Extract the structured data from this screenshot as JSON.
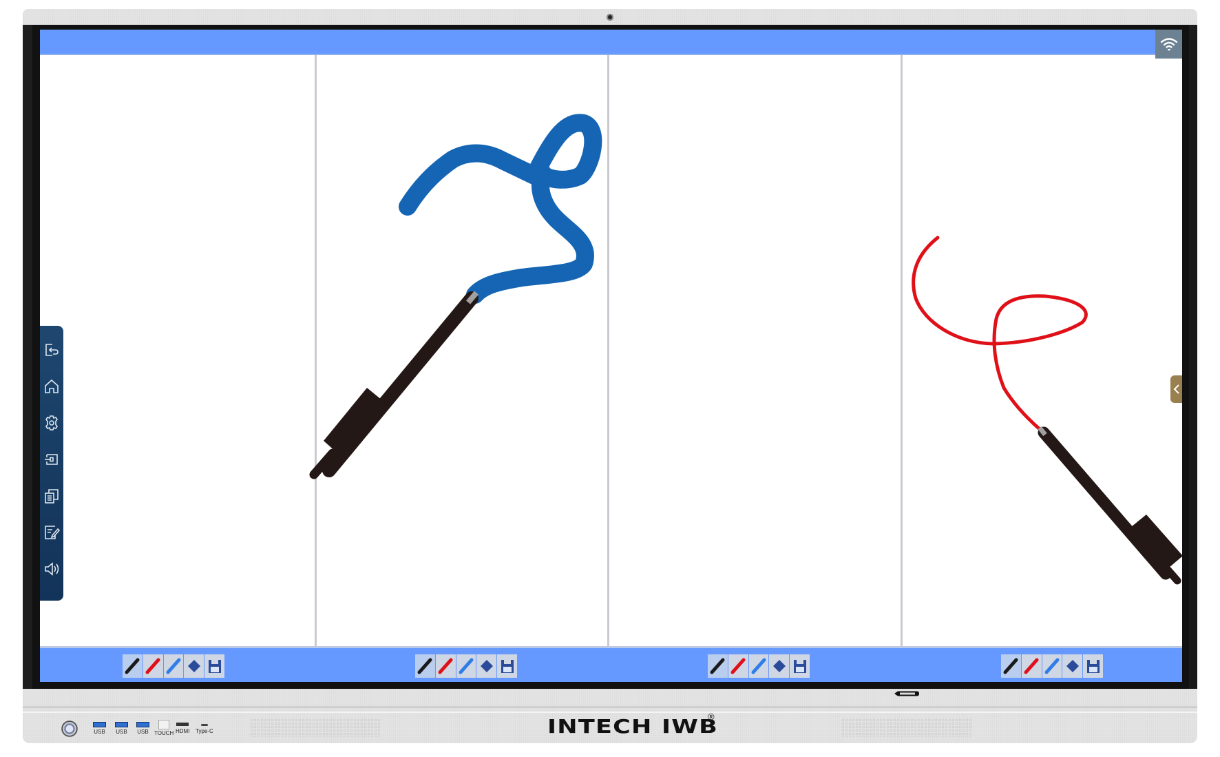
{
  "device": {
    "brand_logo": "INTECH IWB",
    "registered_mark": "®"
  },
  "screen": {
    "topbar_color": "#6699ff",
    "status": {
      "wifi_icon": "wifi-icon"
    },
    "panels_count": 4
  },
  "sidebar": {
    "items": [
      {
        "name": "back",
        "icon": "back-icon"
      },
      {
        "name": "home",
        "icon": "home-icon"
      },
      {
        "name": "settings",
        "icon": "gear-icon"
      },
      {
        "name": "input-source",
        "icon": "input-source-icon"
      },
      {
        "name": "multitask",
        "icon": "windows-icon"
      },
      {
        "name": "annotate",
        "icon": "annotate-icon"
      },
      {
        "name": "volume",
        "icon": "volume-icon"
      }
    ]
  },
  "panels": [
    {
      "stroke_color": "",
      "has_drawing": false
    },
    {
      "stroke_color": "#1565b4",
      "has_drawing": true
    },
    {
      "stroke_color": "",
      "has_drawing": false
    },
    {
      "stroke_color": "#e01018",
      "has_drawing": true
    }
  ],
  "toolbar": {
    "tools": [
      {
        "name": "black-pen",
        "color": "#1a1a1a"
      },
      {
        "name": "red-pen",
        "color": "#e01018"
      },
      {
        "name": "blue-pen",
        "color": "#2f7de8"
      },
      {
        "name": "eraser",
        "color": "#2a4a9a"
      },
      {
        "name": "save",
        "color": "#2a4a9a"
      }
    ]
  },
  "ports": [
    {
      "label": "USB"
    },
    {
      "label": "USB"
    },
    {
      "label": "USB"
    },
    {
      "label": "TOUCH"
    },
    {
      "label": "HDMI"
    },
    {
      "label": "Type-C"
    }
  ]
}
